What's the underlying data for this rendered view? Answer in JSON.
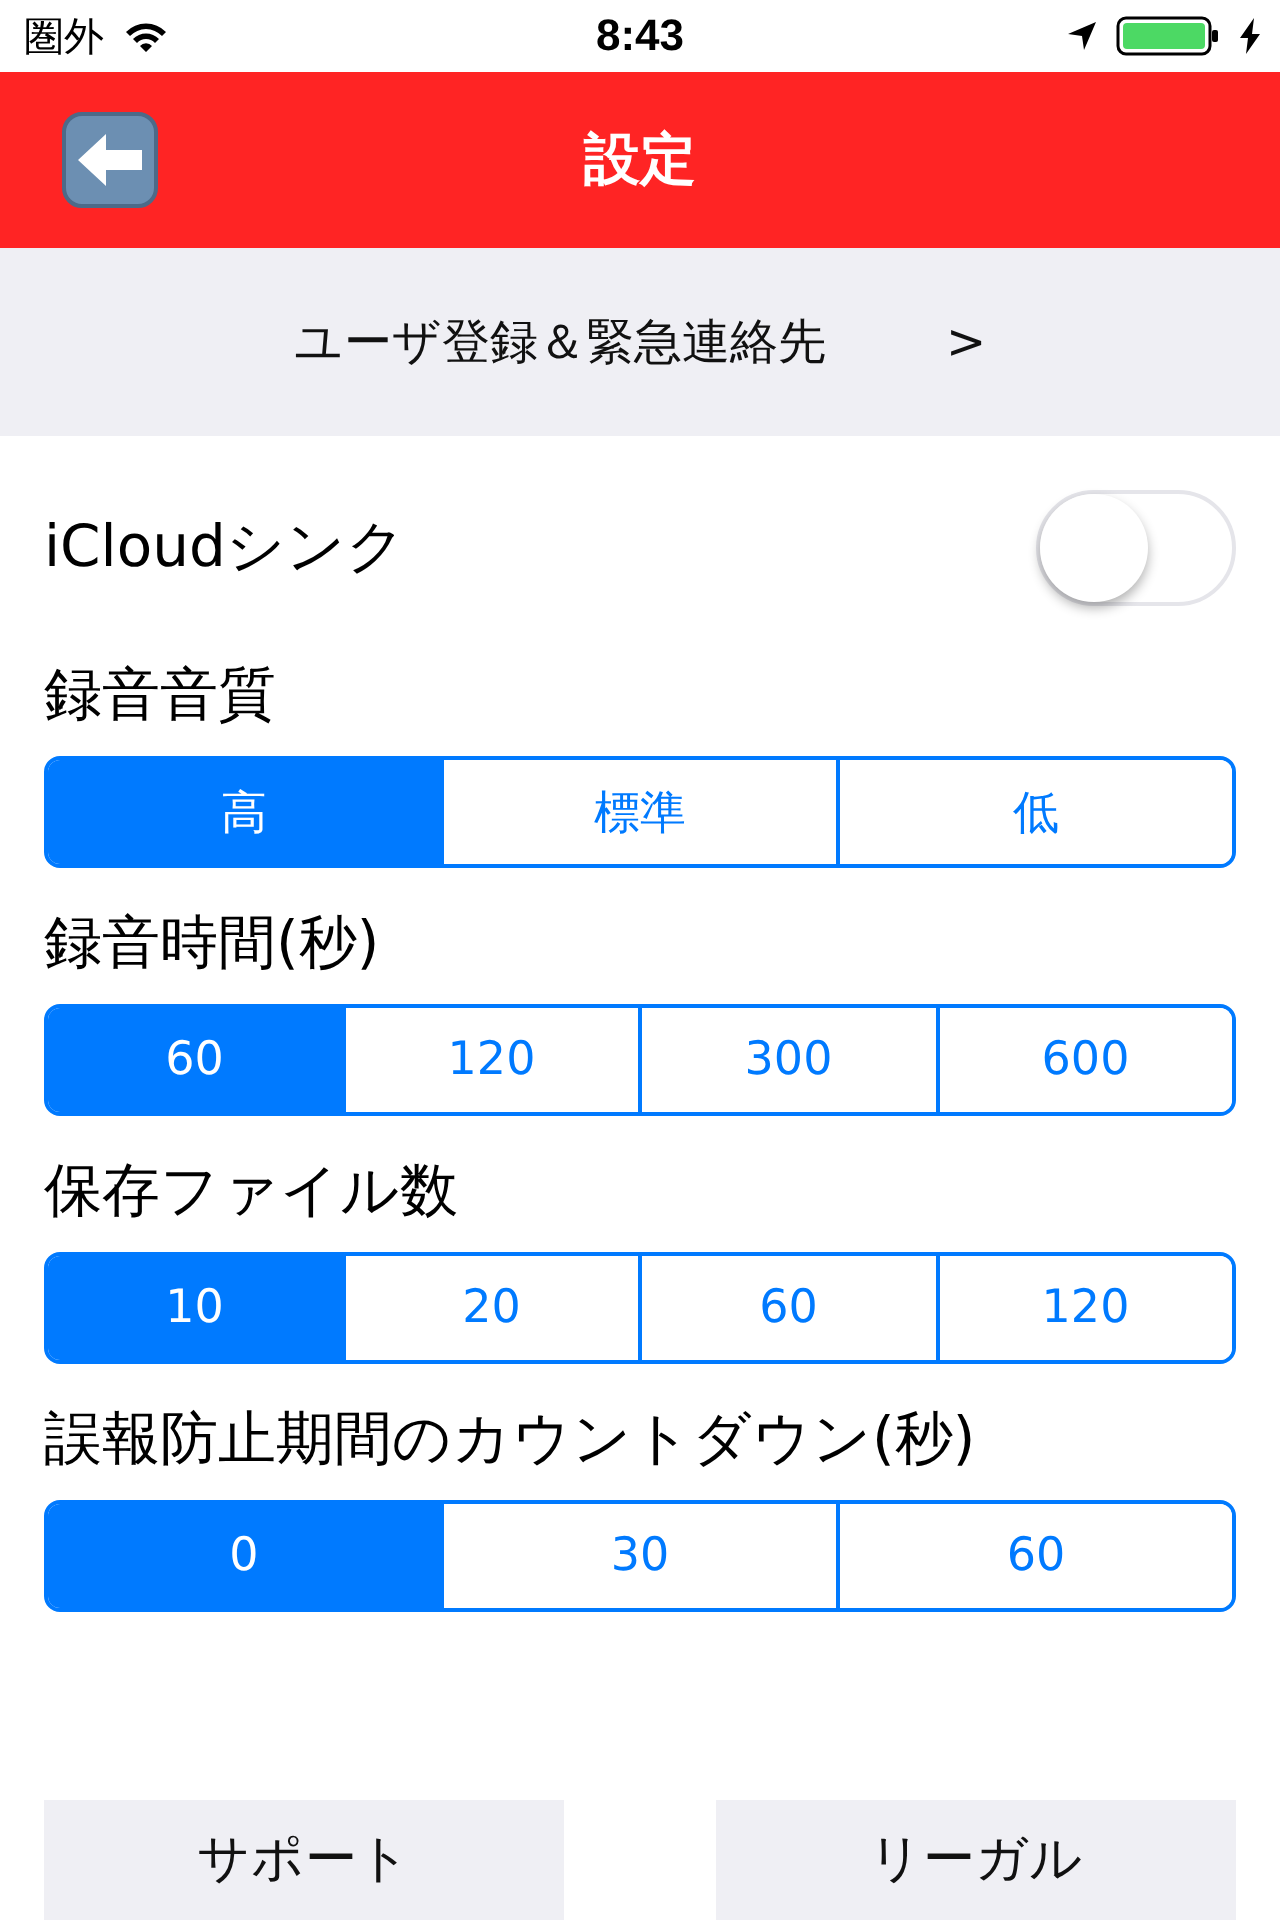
{
  "status_bar": {
    "carrier": "圏外",
    "time": "8:43"
  },
  "nav_bar": {
    "title": "設定"
  },
  "user_row": {
    "label": "ユーザ登録＆緊急連絡先",
    "chevron": ">"
  },
  "icloud": {
    "label": "iCloudシンク",
    "on": false
  },
  "sections": [
    {
      "title": "録音音質",
      "options": [
        {
          "label": "高",
          "selected": true
        },
        {
          "label": "標準",
          "selected": false
        },
        {
          "label": "低",
          "selected": false
        }
      ]
    },
    {
      "title": "録音時間(秒)",
      "options": [
        {
          "label": "60",
          "selected": true
        },
        {
          "label": "120",
          "selected": false
        },
        {
          "label": "300",
          "selected": false
        },
        {
          "label": "600",
          "selected": false
        }
      ]
    },
    {
      "title": "保存ファイル数",
      "options": [
        {
          "label": "10",
          "selected": true
        },
        {
          "label": "20",
          "selected": false
        },
        {
          "label": "60",
          "selected": false
        },
        {
          "label": "120",
          "selected": false
        }
      ]
    },
    {
      "title": "誤報防止期間のカウントダウン(秒)",
      "options": [
        {
          "label": "0",
          "selected": true
        },
        {
          "label": "30",
          "selected": false
        },
        {
          "label": "60",
          "selected": false
        }
      ]
    }
  ],
  "buttons": [
    "サポート",
    "リーガル"
  ]
}
